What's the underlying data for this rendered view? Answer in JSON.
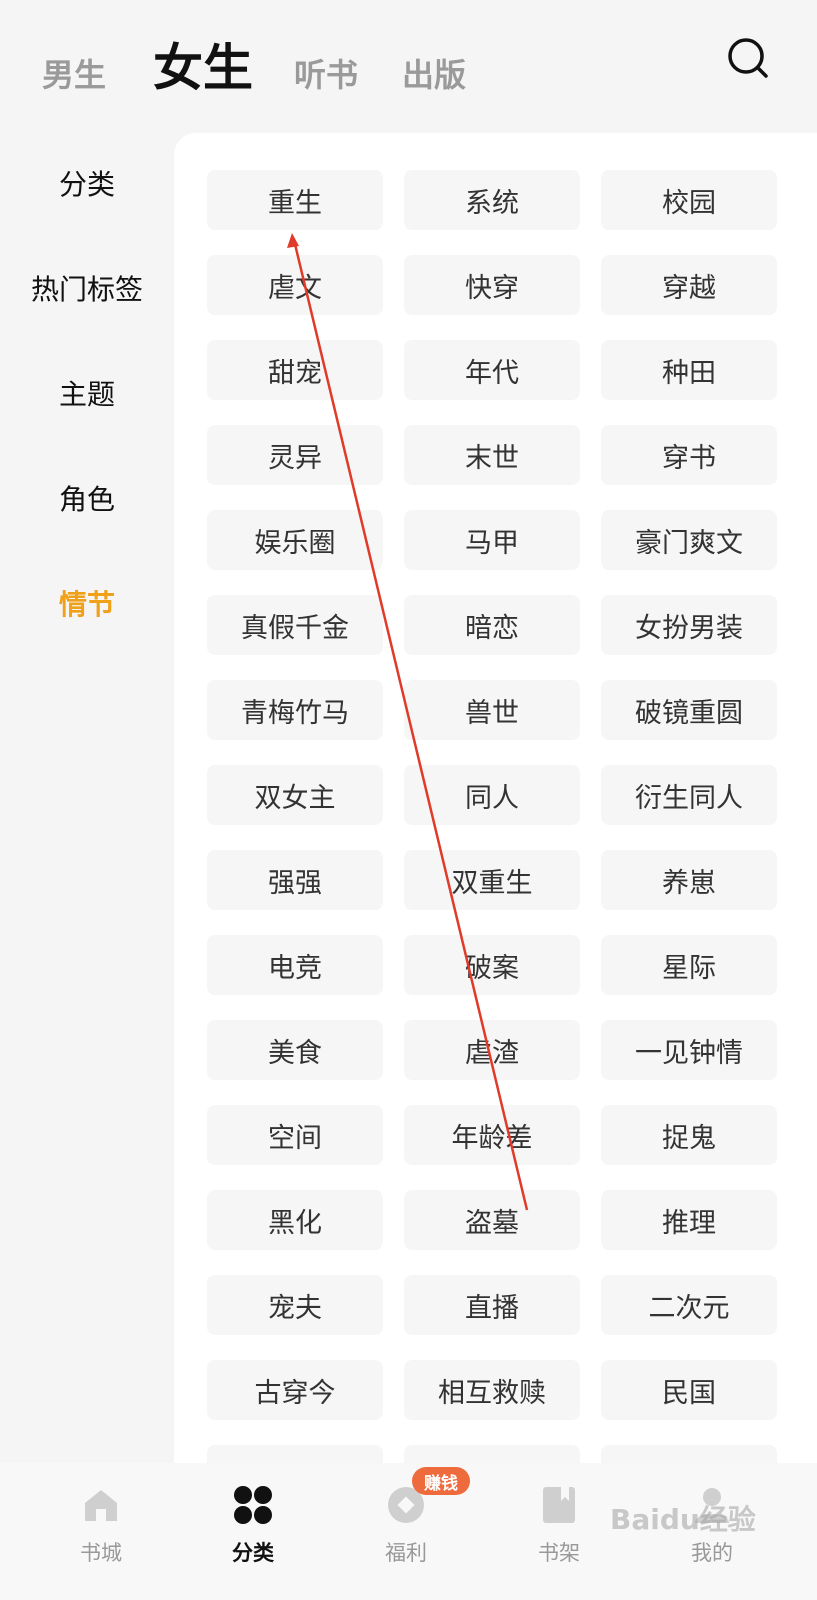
{
  "top_tabs": [
    {
      "label": "男生"
    },
    {
      "label": "女生"
    },
    {
      "label": "听书"
    },
    {
      "label": "出版"
    }
  ],
  "active_top_tab": "女生",
  "search": {
    "icon": "search-icon"
  },
  "sidebar": {
    "items": [
      {
        "label": "分类"
      },
      {
        "label": "热门标签"
      },
      {
        "label": "主题"
      },
      {
        "label": "角色"
      },
      {
        "label": "情节"
      }
    ],
    "active": "情节",
    "accent_color": "#f0a11a"
  },
  "tags": [
    "重生",
    "系统",
    "校园",
    "虐文",
    "快穿",
    "穿越",
    "甜宠",
    "年代",
    "种田",
    "灵异",
    "末世",
    "穿书",
    "娱乐圈",
    "马甲",
    "豪门爽文",
    "真假千金",
    "暗恋",
    "女扮男装",
    "青梅竹马",
    "兽世",
    "破镜重圆",
    "双女主",
    "同人",
    "衍生同人",
    "强强",
    "双重生",
    "养崽",
    "电竞",
    "破案",
    "星际",
    "美食",
    "虐渣",
    "一见钟情",
    "空间",
    "年龄差",
    "捉鬼",
    "黑化",
    "盗墓",
    "推理",
    "宠夫",
    "直播",
    "二次元",
    "古穿今",
    "相互救赎",
    "民国"
  ],
  "bottom_nav": {
    "items": [
      {
        "label": "书城",
        "icon": "home-icon"
      },
      {
        "label": "分类",
        "icon": "category-icon"
      },
      {
        "label": "福利",
        "icon": "coin-icon"
      },
      {
        "label": "书架",
        "icon": "bookshelf-icon"
      },
      {
        "label": "我的",
        "icon": "profile-icon"
      }
    ],
    "active": "分类",
    "badge": "赚钱"
  },
  "watermark": "Baidu经验"
}
